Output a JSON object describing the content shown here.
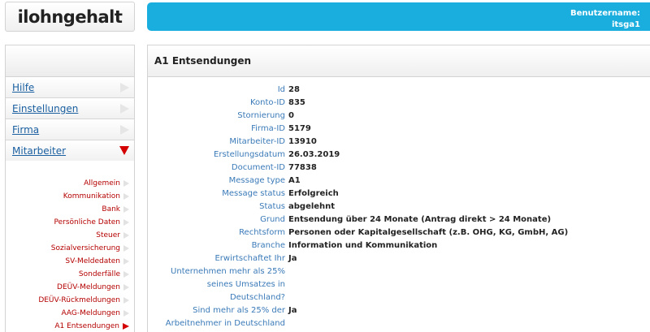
{
  "header": {
    "logo_text": "ilohngehalt",
    "user_label": "Benutzername:",
    "user_value": "itsga1"
  },
  "sidebar": {
    "menu": [
      {
        "label": "Hilfe"
      },
      {
        "label": "Einstellungen"
      },
      {
        "label": "Firma"
      },
      {
        "label": "Mitarbeiter",
        "expanded": true
      }
    ],
    "subitems": [
      {
        "label": "Allgemein"
      },
      {
        "label": "Kommunikation"
      },
      {
        "label": "Bank"
      },
      {
        "label": "Persönliche Daten"
      },
      {
        "label": "Steuer"
      },
      {
        "label": "Sozialversicherung"
      },
      {
        "label": "SV-Meldedaten"
      },
      {
        "label": "Sonderfälle"
      },
      {
        "label": "DEÜV-Meldungen"
      },
      {
        "label": "DEÜV-Rückmeldungen"
      },
      {
        "label": "AAG-Meldungen"
      },
      {
        "label": "A1 Entsendungen",
        "active": true
      }
    ]
  },
  "main": {
    "title": "A1 Entsendungen",
    "fields": [
      {
        "label": "Id",
        "value": "28"
      },
      {
        "label": "Konto-ID",
        "value": "835"
      },
      {
        "label": "Stornierung",
        "value": "0"
      },
      {
        "label": "Firma-ID",
        "value": "5179"
      },
      {
        "label": "Mitarbeiter-ID",
        "value": "13910"
      },
      {
        "label": "Erstellungsdatum",
        "value": "26.03.2019"
      },
      {
        "label": "Document-ID",
        "value": "77838"
      },
      {
        "label": "Message type",
        "value": "A1"
      },
      {
        "label": "Message status",
        "value": "Erfolgreich"
      },
      {
        "label": "Status",
        "value": "abgelehnt"
      },
      {
        "label": "Grund",
        "value": "Entsendung über 24 Monate (Antrag direkt > 24 Monate)"
      },
      {
        "label": "Rechtsform",
        "value": "Personen oder Kapitalgesellschaft (z.B. OHG, KG, GmbH, AG)"
      },
      {
        "label": "Branche",
        "value": "Information und Kommunikation"
      },
      {
        "label": "Erwirtschaftet Ihr",
        "value": "Ja"
      },
      {
        "label": "Unternehmen mehr als 25%",
        "value": ""
      },
      {
        "label": "seines Umsatzes in",
        "value": ""
      },
      {
        "label": "Deutschland?",
        "value": ""
      },
      {
        "label": "Sind mehr als 25% der",
        "value": "Ja"
      },
      {
        "label": "Arbeitnehmer in Deutschland",
        "value": ""
      }
    ]
  }
}
